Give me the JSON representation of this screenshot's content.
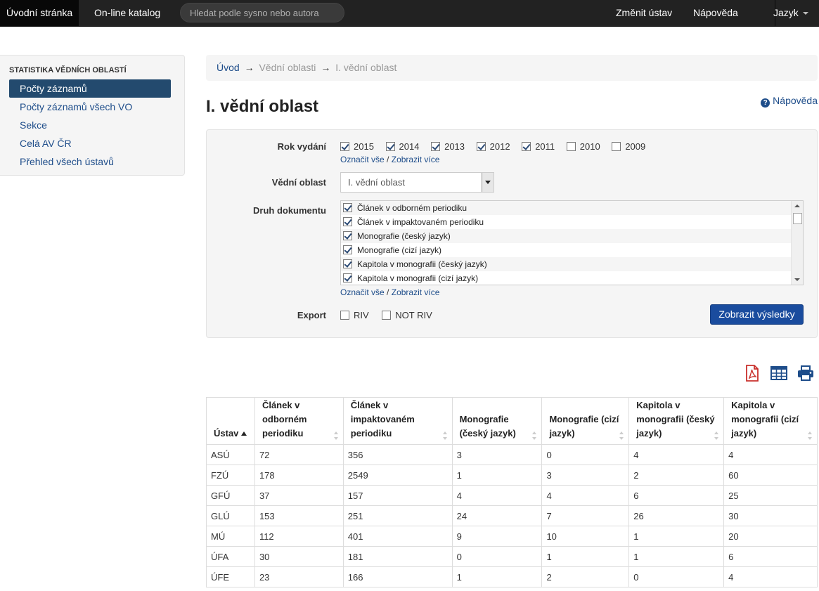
{
  "navbar": {
    "home": "Úvodní stránka",
    "catalog": "On-line katalog",
    "search_placeholder": "Hledat podle sysno nebo autora",
    "change_institute": "Změnit ústav",
    "help": "Nápověda",
    "language": "Jazyk"
  },
  "sidebar": {
    "heading": "STATISTIKA VĚDNÍCH OBLASTÍ",
    "items": [
      {
        "label": "Počty záznamů"
      },
      {
        "label": "Počty záznamů všech VO"
      },
      {
        "label": "Sekce"
      },
      {
        "label": "Celá AV ČR"
      },
      {
        "label": "Přehled všech ústavů"
      }
    ]
  },
  "breadcrumb": {
    "home": "Úvod",
    "arrow": "→",
    "level2": "Vědní oblasti",
    "level3": "I. vědní oblast"
  },
  "page": {
    "title": "I. vědní oblast",
    "help": "Nápověda"
  },
  "filter": {
    "year_label": "Rok vydání",
    "years": [
      {
        "label": "2015",
        "checked": true
      },
      {
        "label": "2014",
        "checked": true
      },
      {
        "label": "2013",
        "checked": true
      },
      {
        "label": "2012",
        "checked": true
      },
      {
        "label": "2011",
        "checked": true
      },
      {
        "label": "2010",
        "checked": false
      },
      {
        "label": "2009",
        "checked": false
      }
    ],
    "select_all": "Označit vše",
    "slash": "/",
    "show_more": "Zobrazit více",
    "area_label": "Vědní oblast",
    "area_value": "I. vědní oblast",
    "doctype_label": "Druh dokumentu",
    "doctypes": [
      {
        "label": "Článek v odborném periodiku",
        "checked": true
      },
      {
        "label": "Článek v impaktovaném periodiku",
        "checked": true
      },
      {
        "label": "Monografie (český jazyk)",
        "checked": true
      },
      {
        "label": "Monografie (cizí jazyk)",
        "checked": true
      },
      {
        "label": "Kapitola v monografii (český jazyk)",
        "checked": true
      },
      {
        "label": "Kapitola v monografii (cizí jazyk)",
        "checked": true
      }
    ],
    "export_label": "Export",
    "export_options": [
      {
        "label": "RIV",
        "checked": false
      },
      {
        "label": "NOT RIV",
        "checked": false
      }
    ],
    "submit": "Zobrazit výsledky"
  },
  "icons": {
    "pdf": "pdf-icon",
    "table": "table-icon",
    "print": "print-icon",
    "pdf_color": "#c9302c",
    "accent": "#1e4d8a"
  },
  "table": {
    "columns": [
      "Ústav",
      "Článek v odborném periodiku",
      "Článek v impaktovaném periodiku",
      "Monografie (český jazyk)",
      "Monografie (cizí jazyk)",
      "Kapitola v monografii (český jazyk)",
      "Kapitola v monografii (cizí jazyk)"
    ],
    "rows": [
      [
        "ASÚ",
        "72",
        "356",
        "3",
        "0",
        "4",
        "4"
      ],
      [
        "FZÚ",
        "178",
        "2549",
        "1",
        "3",
        "2",
        "60"
      ],
      [
        "GFÚ",
        "37",
        "157",
        "4",
        "4",
        "6",
        "25"
      ],
      [
        "GLÚ",
        "153",
        "251",
        "24",
        "7",
        "26",
        "30"
      ],
      [
        "MÚ",
        "112",
        "401",
        "9",
        "10",
        "1",
        "20"
      ],
      [
        "ÚFA",
        "30",
        "181",
        "0",
        "1",
        "1",
        "6"
      ],
      [
        "ÚFE",
        "23",
        "166",
        "1",
        "2",
        "0",
        "4"
      ]
    ]
  }
}
